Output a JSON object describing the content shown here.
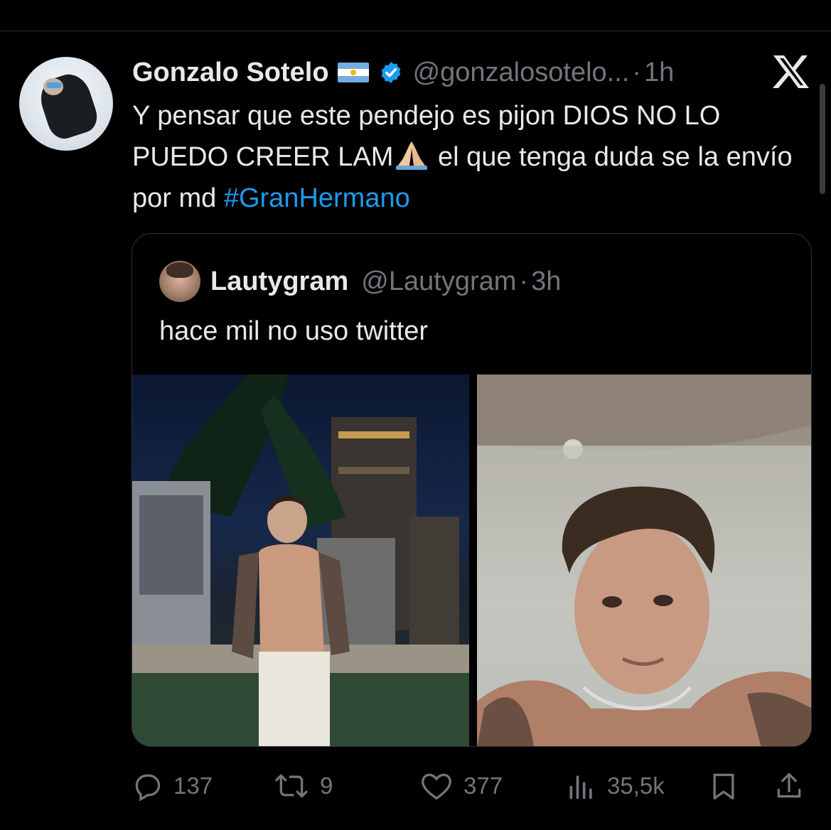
{
  "tweet": {
    "author_name": "Gonzalo Sotelo",
    "author_handle": "@gonzalosotelo...",
    "separator": "·",
    "time": "1h",
    "text_part1": "Y pensar que este pendejo es pijon DIOS NO LO PUEDO CREER LAM",
    "text_part2": "  el que tenga duda se la envío por md ",
    "hashtag": "#GranHermano",
    "emoji_name": "folded-hands-emoji",
    "flag_name": "argentina-flag-icon",
    "verified": true
  },
  "quote": {
    "author_name": "Lautygram",
    "author_handle": "@Lautygram",
    "separator": "·",
    "time": "3h",
    "text": "hace mil no uso twitter",
    "media_count": 2
  },
  "actions": {
    "replies": "137",
    "reposts": "9",
    "likes": "377",
    "views": "35,5k"
  },
  "colors": {
    "background": "#000000",
    "text": "#e7e9ea",
    "muted": "#71767b",
    "link": "#1d9bf0",
    "verified": "#1d9bf0",
    "border": "#2f3336"
  }
}
